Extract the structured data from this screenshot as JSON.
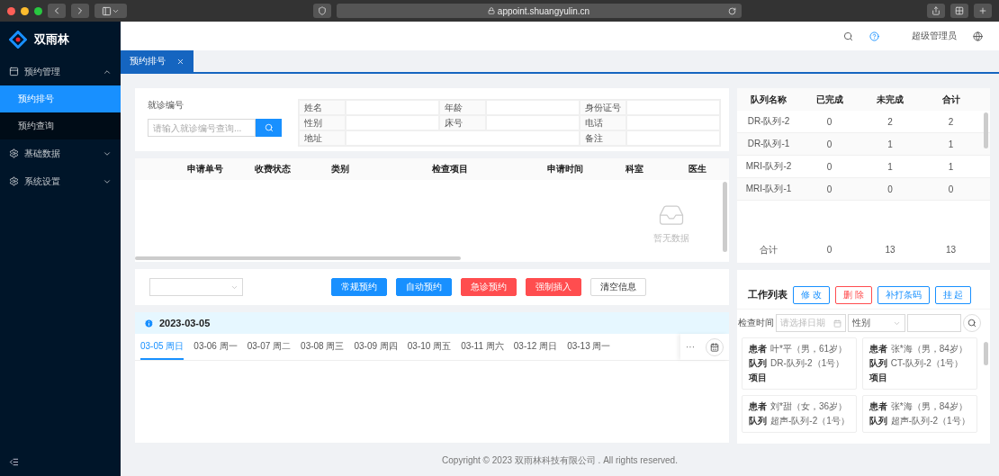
{
  "browser": {
    "url": "appoint.shuangyulin.cn"
  },
  "sidebar": {
    "brand": "双雨林",
    "menu": [
      {
        "label": "预约管理",
        "expanded": true,
        "children": [
          {
            "label": "预约排号",
            "selected": true
          },
          {
            "label": "预约查询",
            "selected": false
          }
        ]
      },
      {
        "label": "基础数据",
        "expanded": false
      },
      {
        "label": "系统设置",
        "expanded": false
      }
    ]
  },
  "header": {
    "user": "超级管理员"
  },
  "tabs": [
    {
      "label": "预约排号",
      "selected": true
    }
  ],
  "patient_search": {
    "label": "就诊编号",
    "placeholder": "请输入就诊编号查询..."
  },
  "patient_info": [
    {
      "label": "姓名"
    },
    {
      "label": "年龄"
    },
    {
      "label": "身份证号"
    },
    {
      "label": "性别"
    },
    {
      "label": "床号"
    },
    {
      "label": "电话"
    },
    {
      "label": "地址"
    },
    {
      "label": "备注"
    }
  ],
  "orders": {
    "columns": [
      "申请单号",
      "收费状态",
      "类别",
      "检查项目",
      "申请时间",
      "科室",
      "医生"
    ],
    "empty_text": "暂无数据"
  },
  "actions": [
    {
      "label": "常规预约",
      "kind": "primary"
    },
    {
      "label": "自动预约",
      "kind": "primary"
    },
    {
      "label": "急诊预约",
      "kind": "danger"
    },
    {
      "label": "强制插入",
      "kind": "danger"
    },
    {
      "label": "清空信息",
      "kind": "default"
    }
  ],
  "schedule": {
    "date": "2023-03-05",
    "more": "···",
    "days": [
      {
        "label": "03-05 周日",
        "selected": true
      },
      {
        "label": "03-06 周一",
        "selected": false
      },
      {
        "label": "03-07 周二",
        "selected": false
      },
      {
        "label": "03-08 周三",
        "selected": false
      },
      {
        "label": "03-09 周四",
        "selected": false
      },
      {
        "label": "03-10 周五",
        "selected": false
      },
      {
        "label": "03-11 周六",
        "selected": false
      },
      {
        "label": "03-12 周日",
        "selected": false
      },
      {
        "label": "03-13 周一",
        "selected": false
      }
    ]
  },
  "queues": {
    "columns": [
      "队列名称",
      "已完成",
      "未完成",
      "合计"
    ],
    "rows": [
      [
        "DR-队列-2",
        "0",
        "2",
        "2"
      ],
      [
        "DR-队列-1",
        "0",
        "1",
        "1"
      ],
      [
        "MRI-队列-2",
        "0",
        "1",
        "1"
      ],
      [
        "MRI-队列-1",
        "0",
        "0",
        "0"
      ]
    ],
    "total": [
      "合计",
      "0",
      "13",
      "13"
    ]
  },
  "worklist": {
    "title": "工作列表",
    "buttons": [
      {
        "label": "修 改",
        "kind": "primary"
      },
      {
        "label": "删 除",
        "kind": "danger"
      },
      {
        "label": "补打条码",
        "kind": "primary"
      },
      {
        "label": "挂 起",
        "kind": "primary"
      }
    ],
    "time_label": "检查时间",
    "date_placeholder": "请选择日期",
    "gender_select": "性别",
    "cards": [
      {
        "patient_label": "患者",
        "patient": "叶*平（男，61岁）",
        "queue_label": "队列",
        "queue": "DR-队列-2（1号）",
        "item_label": "项目"
      },
      {
        "patient_label": "患者",
        "patient": "张*海（男，84岁）",
        "queue_label": "队列",
        "queue": "CT-队列-2（1号）",
        "item_label": "项目"
      },
      {
        "patient_label": "患者",
        "patient": "刘*甜（女，36岁）",
        "queue_label": "队列",
        "queue": "超声-队列-2（1号）"
      },
      {
        "patient_label": "患者",
        "patient": "张*海（男，84岁）",
        "queue_label": "队列",
        "queue": "超声-队列-2（1号）"
      }
    ]
  },
  "footer": "Copyright © 2023 双雨林科技有限公司 . All rights reserved."
}
